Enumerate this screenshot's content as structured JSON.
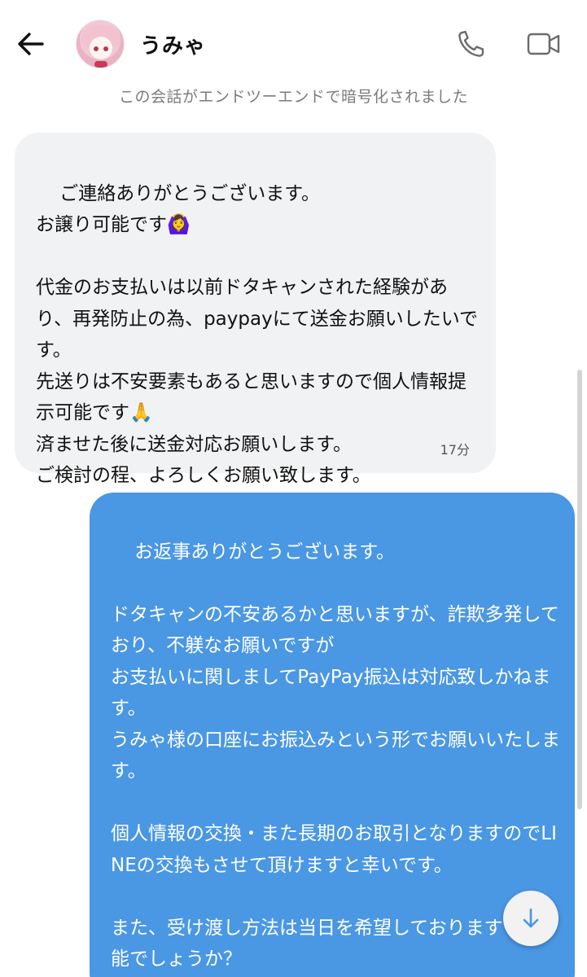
{
  "header": {
    "contact_name": "うみゃ",
    "back_icon": "arrow-left-icon",
    "call_icon": "phone-icon",
    "video_icon": "video-camera-icon"
  },
  "encryption_notice": "この会話がエンドツーエンドで暗号化されました",
  "messages": [
    {
      "direction": "incoming",
      "text": "ご連絡ありがとうございます。\nお譲り可能です🙆‍♀️\n\n代金のお支払いは以前ドタキャンされた経験があり、再発防止の為、paypayにて送金お願いしたいです。\n先送りは不安要素もあると思いますので個人情報提示可能です🙏\n済ませた後に送金対応お願いします。\nご検討の程、よろしくお願い致します。",
      "time": "17分"
    },
    {
      "direction": "outgoing",
      "text": "お返事ありがとうございます。\n\nドタキャンの不安あるかと思いますが、詐欺多発しており、不躾なお願いですが\nお支払いに関しましてPayPay振込は対応致しかねます。\nうみゃ様の口座にお振込みという形でお願いいたします。\n\n個人情報の交換・また長期のお取引となりますのでLINEの交換もさせて頂けますと幸いです。\n\nまた、受け渡し方法は当日を希望しております が可能でしょうか？"
    }
  ],
  "scroll_down_icon": "arrow-down-icon",
  "colors": {
    "incoming_bubble": "#f1f2f4",
    "outgoing_bubble": "#4a97e4",
    "notice_text": "#7b7b7b"
  }
}
